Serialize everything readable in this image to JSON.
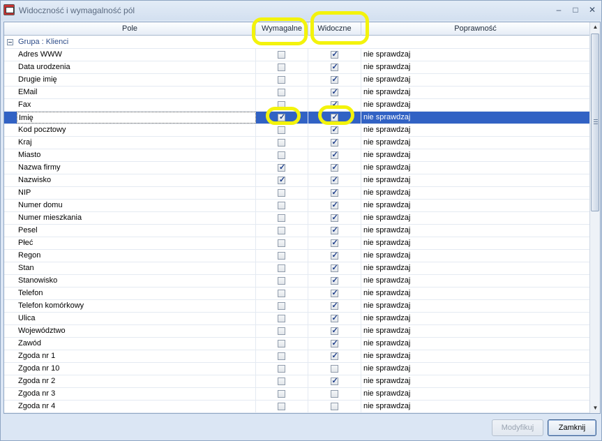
{
  "window": {
    "title": "Widoczność i wymagalność pól",
    "controls": {
      "minimize": "–",
      "maximize": "□",
      "close": "✕"
    }
  },
  "columns": {
    "pole": "Pole",
    "wymagalne": "Wymagalne",
    "widoczne": "Widoczne",
    "poprawnosc": "Poprawność"
  },
  "group": {
    "label": "Grupa : Klienci"
  },
  "rows": [
    {
      "pole": "Adres WWW",
      "wymagalne": false,
      "widoczne": true,
      "poprawnosc": "nie sprawdzaj"
    },
    {
      "pole": "Data urodzenia",
      "wymagalne": false,
      "widoczne": true,
      "poprawnosc": "nie sprawdzaj"
    },
    {
      "pole": "Drugie imię",
      "wymagalne": false,
      "widoczne": true,
      "poprawnosc": "nie sprawdzaj"
    },
    {
      "pole": "EMail",
      "wymagalne": false,
      "widoczne": true,
      "poprawnosc": "nie sprawdzaj"
    },
    {
      "pole": "Fax",
      "wymagalne": false,
      "widoczne": true,
      "poprawnosc": "nie sprawdzaj"
    },
    {
      "pole": "Imię",
      "wymagalne": true,
      "widoczne": true,
      "poprawnosc": "nie sprawdzaj",
      "selected": true
    },
    {
      "pole": "Kod pocztowy",
      "wymagalne": false,
      "widoczne": true,
      "poprawnosc": "nie sprawdzaj"
    },
    {
      "pole": "Kraj",
      "wymagalne": false,
      "widoczne": true,
      "poprawnosc": "nie sprawdzaj"
    },
    {
      "pole": "Miasto",
      "wymagalne": false,
      "widoczne": true,
      "poprawnosc": "nie sprawdzaj"
    },
    {
      "pole": "Nazwa firmy",
      "wymagalne": true,
      "widoczne": true,
      "poprawnosc": "nie sprawdzaj"
    },
    {
      "pole": "Nazwisko",
      "wymagalne": true,
      "widoczne": true,
      "poprawnosc": "nie sprawdzaj"
    },
    {
      "pole": "NIP",
      "wymagalne": false,
      "widoczne": true,
      "poprawnosc": "nie sprawdzaj"
    },
    {
      "pole": "Numer domu",
      "wymagalne": false,
      "widoczne": true,
      "poprawnosc": "nie sprawdzaj"
    },
    {
      "pole": "Numer mieszkania",
      "wymagalne": false,
      "widoczne": true,
      "poprawnosc": "nie sprawdzaj"
    },
    {
      "pole": "Pesel",
      "wymagalne": false,
      "widoczne": true,
      "poprawnosc": "nie sprawdzaj"
    },
    {
      "pole": "Płeć",
      "wymagalne": false,
      "widoczne": true,
      "poprawnosc": "nie sprawdzaj"
    },
    {
      "pole": "Regon",
      "wymagalne": false,
      "widoczne": true,
      "poprawnosc": "nie sprawdzaj"
    },
    {
      "pole": "Stan",
      "wymagalne": false,
      "widoczne": true,
      "poprawnosc": "nie sprawdzaj"
    },
    {
      "pole": "Stanowisko",
      "wymagalne": false,
      "widoczne": true,
      "poprawnosc": "nie sprawdzaj"
    },
    {
      "pole": "Telefon",
      "wymagalne": false,
      "widoczne": true,
      "poprawnosc": "nie sprawdzaj"
    },
    {
      "pole": "Telefon komórkowy",
      "wymagalne": false,
      "widoczne": true,
      "poprawnosc": "nie sprawdzaj"
    },
    {
      "pole": "Ulica",
      "wymagalne": false,
      "widoczne": true,
      "poprawnosc": "nie sprawdzaj"
    },
    {
      "pole": "Województwo",
      "wymagalne": false,
      "widoczne": true,
      "poprawnosc": "nie sprawdzaj"
    },
    {
      "pole": "Zawód",
      "wymagalne": false,
      "widoczne": true,
      "poprawnosc": "nie sprawdzaj"
    },
    {
      "pole": "Zgoda nr 1",
      "wymagalne": false,
      "widoczne": true,
      "poprawnosc": "nie sprawdzaj"
    },
    {
      "pole": "Zgoda nr 10",
      "wymagalne": false,
      "widoczne": false,
      "poprawnosc": "nie sprawdzaj"
    },
    {
      "pole": "Zgoda nr 2",
      "wymagalne": false,
      "widoczne": true,
      "poprawnosc": "nie sprawdzaj"
    },
    {
      "pole": "Zgoda nr 3",
      "wymagalne": false,
      "widoczne": false,
      "poprawnosc": "nie sprawdzaj"
    },
    {
      "pole": "Zgoda nr 4",
      "wymagalne": false,
      "widoczne": false,
      "poprawnosc": "nie sprawdzaj"
    }
  ],
  "buttons": {
    "modyfikuj": "Modyfikuj",
    "zamknij": "Zamknij"
  },
  "colors": {
    "selection": "#3162c4",
    "highlight": "#f3f30c",
    "group_text": "#2e4d8a"
  }
}
